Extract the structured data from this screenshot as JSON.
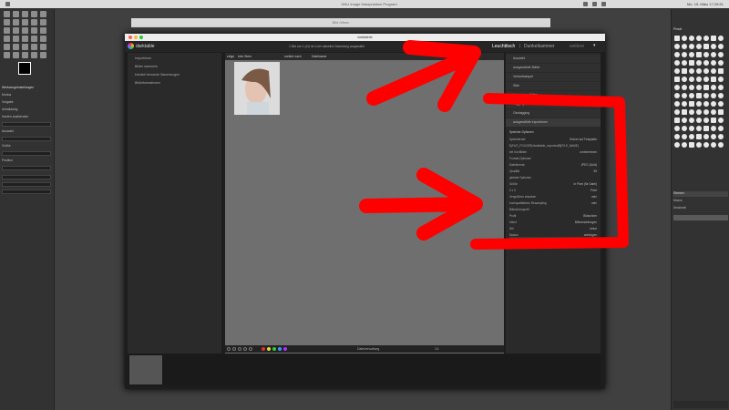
{
  "menubar": {
    "title": "GNU Image Manipulation Program",
    "clock": "Mo. 15. März 17:26:51"
  },
  "bg_dialog": {
    "title": "Bild öffnen"
  },
  "darktable": {
    "window_title": "darktable",
    "logo_text": "darktable",
    "status": "1 Bild von 1 (#1) ist in der aktuellen Sammlung ausgewählt",
    "views": {
      "lighttable": "Leuchttisch",
      "sep": "|",
      "darkroom": "Dunkelkammer",
      "more": "weitere"
    },
    "left_modules": [
      "Importieren",
      "Bilder sammeln",
      "kürzlich benutzte Sammlungen",
      "Bildinformationen"
    ],
    "filter": {
      "label": "zeige",
      "value": "kein Stern",
      "sort_label": "sortiert nach",
      "sort_value": "Dateiname"
    },
    "right_modules": [
      "Auswahl",
      "ausgewählte Bilder",
      "Verlaufsstapel",
      "Stile",
      "Metadaten-Editor",
      "Tagging",
      "Geotagging",
      "ausgewählte exportieren"
    ],
    "export_section": "Speicher-Optionen",
    "export_rows": [
      {
        "label": "Speicherziel",
        "value": "Ordner auf Festplatte"
      },
      {
        "label": "$(FILE_FOLDER)/darktable_exported/$(FILE_NAME)",
        "value": ""
      },
      {
        "label": "bei Konflikten",
        "value": "umbenennen"
      },
      {
        "label": "Format-Optionen",
        "value": ""
      },
      {
        "label": "Dateiformat",
        "value": "JPEG (8-bit)"
      },
      {
        "label": "Qualität",
        "value": "95"
      },
      {
        "label": "globale Optionen",
        "value": ""
      },
      {
        "label": "Größe",
        "value": "in Pixel (für Datei)"
      },
      {
        "label": "0 x 0",
        "value": "Pixel"
      },
      {
        "label": "Vergrößern erlauben",
        "value": "nein"
      },
      {
        "label": "hochqualitatives Resampling",
        "value": "nein"
      },
      {
        "label": "Bildschirmprofil",
        "value": ""
      },
      {
        "label": "Profil",
        "value": "Bildschirm"
      },
      {
        "label": "Intent",
        "value": "Bildeinstellungen"
      },
      {
        "label": "Stil",
        "value": "keine"
      },
      {
        "label": "Modus",
        "value": "anhängen"
      }
    ],
    "export_button": "exportieren",
    "bottom_label": "Dateiverwaltung",
    "page_indicator": "1/1"
  },
  "gimp_left": {
    "options_title": "Werkzeugeinstellungen",
    "rows": [
      "Modus",
      "Vorgabe",
      "Antialiasing",
      "Kanten ausblenden",
      "Auswahl",
      "Größe",
      "Position"
    ]
  },
  "gimp_right": {
    "brushes_title": "Pinsel",
    "layers_title": "Ebenen",
    "mode_label": "Modus",
    "opacity_label": "Deckkraft"
  },
  "colors": {
    "accent": "#ff0000",
    "dt_bg": "#1d1d1d",
    "dt_center": "#6f6f6f"
  }
}
